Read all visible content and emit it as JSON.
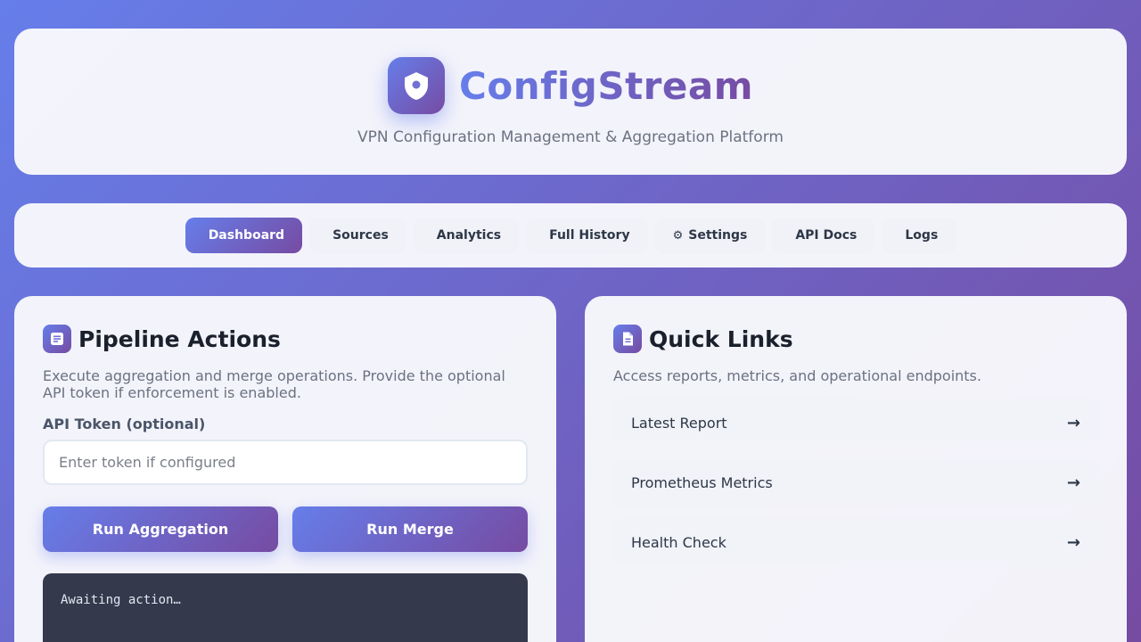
{
  "header": {
    "logo_icon": "shield-icon",
    "title": "ConfigStream",
    "subtitle": "VPN Configuration Management & Aggregation Platform"
  },
  "nav": {
    "items": [
      {
        "icon": "",
        "label": "Dashboard",
        "active": true
      },
      {
        "icon": "",
        "label": "Sources"
      },
      {
        "icon": "",
        "label": "Analytics"
      },
      {
        "icon": "",
        "label": "Full History"
      },
      {
        "icon": "⚙",
        "label": "Settings"
      },
      {
        "icon": "",
        "label": "API Docs"
      },
      {
        "icon": "",
        "label": "Logs"
      }
    ]
  },
  "pipeline": {
    "icon": "document-icon",
    "title": "Pipeline Actions",
    "description": "Execute aggregation and merge operations. Provide the optional API token if enforcement is enabled.",
    "token_label": "API Token (optional)",
    "token_placeholder": "Enter token if configured",
    "token_value": "",
    "run_aggregation": "Run Aggregation",
    "run_merge": "Run Merge",
    "console_text": "Awaiting action…"
  },
  "quick_links": {
    "icon": "file-icon",
    "title": "Quick Links",
    "description": "Access reports, metrics, and operational endpoints.",
    "items": [
      {
        "label": "Latest Report",
        "arrow": "→"
      },
      {
        "label": "Prometheus Metrics",
        "arrow": "→"
      },
      {
        "label": "Health Check",
        "arrow": "→"
      }
    ]
  },
  "colors": {
    "accent_start": "#667eea",
    "accent_end": "#764ba2",
    "console_bg": "#343a4c"
  }
}
